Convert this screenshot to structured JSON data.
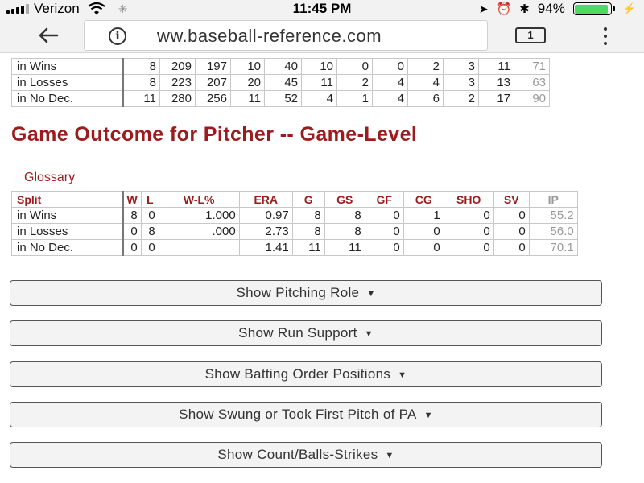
{
  "status": {
    "carrier": "Verizon",
    "time": "11:45 PM",
    "battery": "94%",
    "battery_level": 0.94
  },
  "browser": {
    "url": "ww.baseball-reference.com",
    "tab_count": "1"
  },
  "top_table": {
    "rows": [
      {
        "label": "in Wins",
        "values": [
          "8",
          "209",
          "197",
          "10",
          "40",
          "10",
          "0",
          "0",
          "2",
          "3",
          "11",
          "71"
        ]
      },
      {
        "label": "in Losses",
        "values": [
          "8",
          "223",
          "207",
          "20",
          "45",
          "11",
          "2",
          "4",
          "4",
          "3",
          "13",
          "63"
        ]
      },
      {
        "label": "in No Dec.",
        "values": [
          "11",
          "280",
          "256",
          "11",
          "52",
          "4",
          "1",
          "4",
          "6",
          "2",
          "17",
          "90"
        ]
      }
    ]
  },
  "section": {
    "heading": "Game Outcome for Pitcher -- Game-Level",
    "glossary": "Glossary"
  },
  "outcome_table": {
    "headers": [
      "Split",
      "W",
      "L",
      "W-L%",
      "ERA",
      "G",
      "GS",
      "GF",
      "CG",
      "SHO",
      "SV",
      "IP"
    ],
    "rows": [
      {
        "label": "in Wins",
        "values": [
          "8",
          "0",
          "1.000",
          "0.97",
          "8",
          "8",
          "0",
          "1",
          "0",
          "0",
          "55.2"
        ]
      },
      {
        "label": "in Losses",
        "values": [
          "0",
          "8",
          ".000",
          "2.73",
          "8",
          "8",
          "0",
          "0",
          "0",
          "0",
          "56.0"
        ]
      },
      {
        "label": "in No Dec.",
        "values": [
          "0",
          "0",
          "",
          "1.41",
          "11",
          "11",
          "0",
          "0",
          "0",
          "0",
          "70.1"
        ]
      }
    ]
  },
  "toggles": [
    {
      "label": "Show Pitching Role"
    },
    {
      "label": "Show Run Support"
    },
    {
      "label": "Show Batting Order Positions"
    },
    {
      "label": "Show Swung or Took First Pitch of PA"
    },
    {
      "label": "Show Count/Balls-Strikes"
    }
  ],
  "icons": {
    "back": "arrow-left-icon",
    "info": "info-circle-icon",
    "tabs": "tab-switcher-icon",
    "menu": "more-vert-icon",
    "caret": "caret-down-icon"
  }
}
